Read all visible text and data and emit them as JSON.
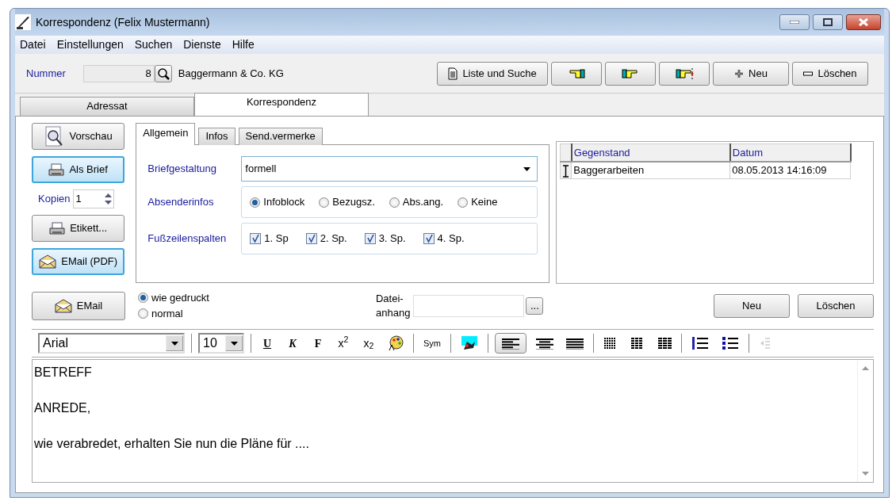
{
  "window": {
    "title": "Korrespondenz (Felix Mustermann)"
  },
  "menu": [
    "Datei",
    "Einstellungen",
    "Suchen",
    "Dienste",
    "Hilfe"
  ],
  "header": {
    "number_label": "Nummer",
    "number_value": "8",
    "company": "Baggermann & Co. KG"
  },
  "header_buttons": [
    {
      "kind": "list",
      "label": "Liste und Suche"
    },
    {
      "kind": "previous"
    },
    {
      "kind": "next"
    },
    {
      "kind": "last"
    },
    {
      "kind": "add",
      "label": "Neu"
    },
    {
      "kind": "delete",
      "label": "Löschen"
    }
  ],
  "main_tabs": [
    {
      "label": "Adressat",
      "selected": false
    },
    {
      "label": "Korrespondenz",
      "selected": true
    }
  ],
  "side_buttons": [
    {
      "kind": "preview",
      "label": "Vorschau",
      "highlighted": false
    },
    {
      "kind": "print",
      "label": "Als Brief",
      "highlighted": true
    },
    {
      "kind": "copies",
      "label": "Kopien",
      "value": "1"
    },
    {
      "kind": "print",
      "label": "Etikett...",
      "highlighted": false
    },
    {
      "kind": "mail",
      "label": "EMail (PDF)",
      "highlighted": true
    }
  ],
  "sub_tabs": [
    {
      "label": "Allgemein",
      "selected": true
    },
    {
      "label": "Infos",
      "selected": false
    },
    {
      "label": "Send.vermerke",
      "selected": false
    }
  ],
  "letter_layout": {
    "label": "Briefgestaltung",
    "value": "formell"
  },
  "sender_info": {
    "label": "Absenderinfos",
    "options": [
      {
        "label": "Infoblock",
        "selected": true
      },
      {
        "label": "Bezugsz.",
        "selected": false
      },
      {
        "label": "Abs.ang.",
        "selected": false
      },
      {
        "label": "Keine",
        "selected": false
      }
    ]
  },
  "footer_columns": {
    "label": "Fußzeilenspalten",
    "options": [
      {
        "label": "1. Sp",
        "checked": true
      },
      {
        "label": "2. Sp.",
        "checked": true
      },
      {
        "label": "3. Sp.",
        "checked": true
      },
      {
        "label": "4. Sp.",
        "checked": true
      }
    ]
  },
  "email_button": {
    "label": "EMail"
  },
  "email_mode": [
    {
      "label": "wie gedruckt",
      "selected": true
    },
    {
      "label": "normal",
      "selected": false
    }
  ],
  "attachment": {
    "label_lines": [
      "Datei-",
      "anhang"
    ],
    "browse": "..."
  },
  "table": {
    "columns": [
      "Gegenstand",
      "Datum"
    ],
    "rows": [
      {
        "cells": [
          "Baggerarbeiten",
          "08.05.2013 14:16:09"
        ],
        "selected": true
      }
    ]
  },
  "table_buttons": [
    "Neu",
    "Löschen"
  ],
  "editor_toolbar": {
    "font": "Arial",
    "size": "10",
    "items": [
      {
        "kind": "underline",
        "label": "U"
      },
      {
        "kind": "italic",
        "label": "K"
      },
      {
        "kind": "bold",
        "label": "F"
      },
      {
        "kind": "superscript",
        "label": "x$^{2}$"
      },
      {
        "kind": "subscript",
        "label": "x$_{2}$"
      },
      {
        "kind": "color"
      },
      {
        "kind": "sep"
      },
      {
        "kind": "symbol",
        "label": "Sym"
      },
      {
        "kind": "sep"
      },
      {
        "kind": "picture"
      },
      {
        "kind": "sep"
      },
      {
        "kind": "align-left",
        "selected": true
      },
      {
        "kind": "align-center",
        "selected": false
      },
      {
        "kind": "justify",
        "selected": false
      },
      {
        "kind": "sep"
      },
      {
        "kind": "grid-dense"
      },
      {
        "kind": "grid"
      },
      {
        "kind": "grid-light"
      },
      {
        "kind": "sep"
      },
      {
        "kind": "numbered-list"
      },
      {
        "kind": "bullet-list"
      },
      {
        "kind": "sep"
      },
      {
        "kind": "outdent",
        "disabled": true
      }
    ]
  },
  "editor_text": [
    "BETREFF",
    "ANREDE,",
    "wie verabredet, erhalten Sie nun die Pläne für ...."
  ]
}
